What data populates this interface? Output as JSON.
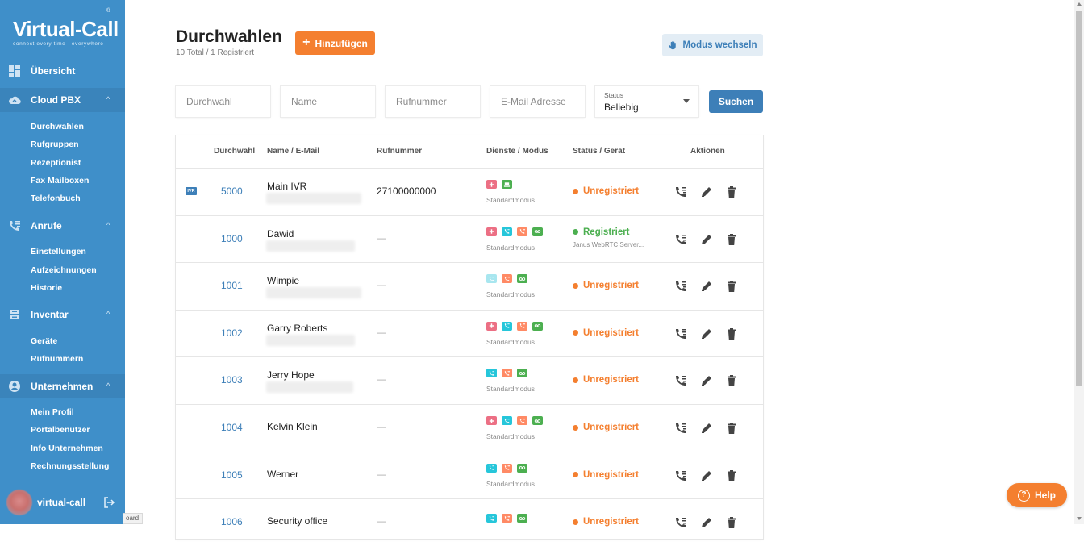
{
  "app": {
    "logo_title": "Virtual-Call",
    "logo_tagline": "connect every time - everywhere",
    "logo_reg": "®"
  },
  "sidebar": {
    "sections": [
      {
        "label": "Übersicht",
        "icon": "dashboard-icon",
        "chevron": ""
      },
      {
        "label": "Cloud PBX",
        "icon": "cloud-icon",
        "chevron": "^",
        "items": [
          "Durchwahlen",
          "Rufgruppen",
          "Rezeptionist",
          "Fax Mailboxen",
          "Telefonbuch"
        ]
      },
      {
        "label": "Anrufe",
        "icon": "phone-list-icon",
        "chevron": "^",
        "items": [
          "Einstellungen",
          "Aufzeichnungen",
          "Historie"
        ]
      },
      {
        "label": "Inventar",
        "icon": "inbox-icon",
        "chevron": "^",
        "items": [
          "Geräte",
          "Rufnummern"
        ]
      },
      {
        "label": "Unternehmen",
        "icon": "account-circle-icon",
        "chevron": "^",
        "items": [
          "Mein Profil",
          "Portalbenutzer",
          "Info Unternehmen",
          "Rechnungsstellung"
        ]
      }
    ],
    "user": {
      "name": "virtual-call"
    },
    "tooltip": "oard"
  },
  "header": {
    "title": "Durchwahlen",
    "subtitle": "10 Total / 1 Registriert",
    "add_label": "Hinzufügen",
    "mode_label": "Modus wechseln"
  },
  "filters": {
    "extension_placeholder": "Durchwahl",
    "name_placeholder": "Name",
    "number_placeholder": "Rufnummer",
    "email_placeholder": "E-Mail Adresse",
    "status_caption": "Status",
    "status_value": "Beliebig",
    "search_label": "Suchen"
  },
  "table": {
    "headers": {
      "extension": "Durchwahl",
      "name": "Name / E-Mail",
      "number": "Rufnummer",
      "services": "Dienste / Modus",
      "status": "Status / Gerät",
      "actions": "Aktionen"
    },
    "rows": [
      {
        "badge": "IVR",
        "extension": "5000",
        "name": "Main IVR",
        "number": "27100000000",
        "services": [
          "dnd",
          "fax"
        ],
        "mode": "Standardmodus",
        "status": "Unregistriert",
        "device": ""
      },
      {
        "badge": "",
        "extension": "1000",
        "name": "Dawid",
        "number": "—",
        "services": [
          "dnd",
          "call",
          "forward",
          "voicemail"
        ],
        "mode": "Standardmodus",
        "status": "Registriert",
        "device": "Janus WebRTC Server..."
      },
      {
        "badge": "",
        "extension": "1001",
        "name": "Wimpie",
        "number": "—",
        "services": [
          "call-light",
          "forward",
          "voicemail"
        ],
        "mode": "Standardmodus",
        "status": "Unregistriert",
        "device": ""
      },
      {
        "badge": "",
        "extension": "1002",
        "name": "Garry Roberts",
        "number": "—",
        "services": [
          "dnd",
          "call",
          "forward",
          "voicemail"
        ],
        "mode": "Standardmodus",
        "status": "Unregistriert",
        "device": ""
      },
      {
        "badge": "",
        "extension": "1003",
        "name": "Jerry Hope",
        "number": "—",
        "services": [
          "call",
          "forward",
          "voicemail"
        ],
        "mode": "Standardmodus",
        "status": "Unregistriert",
        "device": ""
      },
      {
        "badge": "",
        "extension": "1004",
        "name": "Kelvin Klein",
        "number": "—",
        "services": [
          "dnd",
          "call",
          "forward",
          "voicemail"
        ],
        "mode": "Standardmodus",
        "status": "Unregistriert",
        "device": ""
      },
      {
        "badge": "",
        "extension": "1005",
        "name": "Werner",
        "number": "—",
        "services": [
          "call",
          "forward",
          "voicemail"
        ],
        "mode": "Standardmodus",
        "status": "Unregistriert",
        "device": ""
      },
      {
        "badge": "",
        "extension": "1006",
        "name": "Security office",
        "number": "—",
        "services": [
          "call",
          "forward",
          "voicemail"
        ],
        "mode": "",
        "status": "Unregistriert",
        "device": ""
      }
    ]
  },
  "help": {
    "label": "Help"
  },
  "colors": {
    "sidebar": "#3f8fc9",
    "accent_orange": "#f47f2f",
    "primary_blue": "#3d7fb8",
    "registered_green": "#4caf50",
    "unregistered_orange": "#f47f2f",
    "svc_dnd": "#ec6f84",
    "svc_fax": "#4caf50",
    "svc_call": "#26c6da",
    "svc_call_light": "#a8e6ef",
    "svc_forward": "#ff8a65",
    "svc_voicemail": "#4caf50"
  }
}
